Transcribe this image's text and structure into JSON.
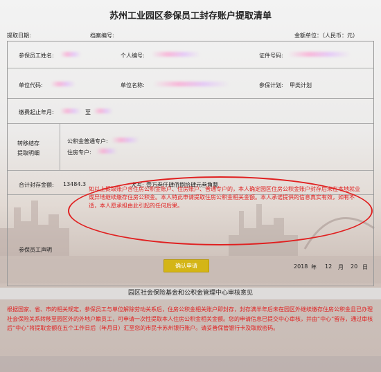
{
  "title": "苏州工业园区参保员工封存账户提取清单",
  "header": {
    "withdraw_date_label": "提取日期:",
    "archive_no_label": "档案编号:",
    "amount_unit_label": "金额单位：（人民币：元）"
  },
  "row1": {
    "employee_name_label": "参保员工姓名:",
    "personal_no_label": "个人编号:",
    "id_no_label": "证件号码:"
  },
  "row2": {
    "unit_code_label": "单位代码:",
    "unit_name_label": "单位名称:",
    "plan_label": "参保计划:",
    "plan_value": "甲类计划"
  },
  "row3": {
    "period_label": "缴费起止年月:",
    "to_label": "至"
  },
  "transfer": {
    "section_label_line1": "转移结存",
    "section_label_line2": "提取明细",
    "fund_label": "公积金普通专户:",
    "housing_label": "住房专户:"
  },
  "total": {
    "total_label": "合计封存金额:",
    "total_value": "13484.3",
    "uppercase_label": "大写:",
    "uppercase_value": "壹万叁仟肆佰捌拾肆元叁角整"
  },
  "declaration": {
    "label": "参保员工声明",
    "text": "如以上提取账户含住房公积金账户、住房账户、普通专户的，本人确定园区住房公积金账户封存后未在本地就业或异地继续缴存住房公积金。本人特此申请提取住房公积金相关金额。本人承诺提供的信息真实有效，如有不适，本人愿承担由此引起的任何后果。",
    "confirm_button": "确认申请",
    "year": "2018",
    "year_unit": "年",
    "month": "12",
    "month_unit": "月",
    "day": "20",
    "day_unit": "日"
  },
  "review": {
    "title": "园区社会保险基金和公积金管理中心审核意见",
    "note": "根据国家、省、市的相关规定，参保员工与单位解除劳动关系后，住房公积金相关账户即封存，封存满半年后未在园区外继续缴存住房公积金且已办理社会保险关系转移至园区外的外地户籍员工，可申请一次性提取本人住房公积金相关金额。您的申请信息已提交中心审核，并由“中心”留存，通过审核后“中心”将提取金额在五个工作日后（年月日）汇至您的市民卡苏州银行账户。请妥善保管银行卡及取款密码。"
  },
  "colors": {
    "accent_red": "#e02020",
    "button_yellow": "#d4b516"
  }
}
